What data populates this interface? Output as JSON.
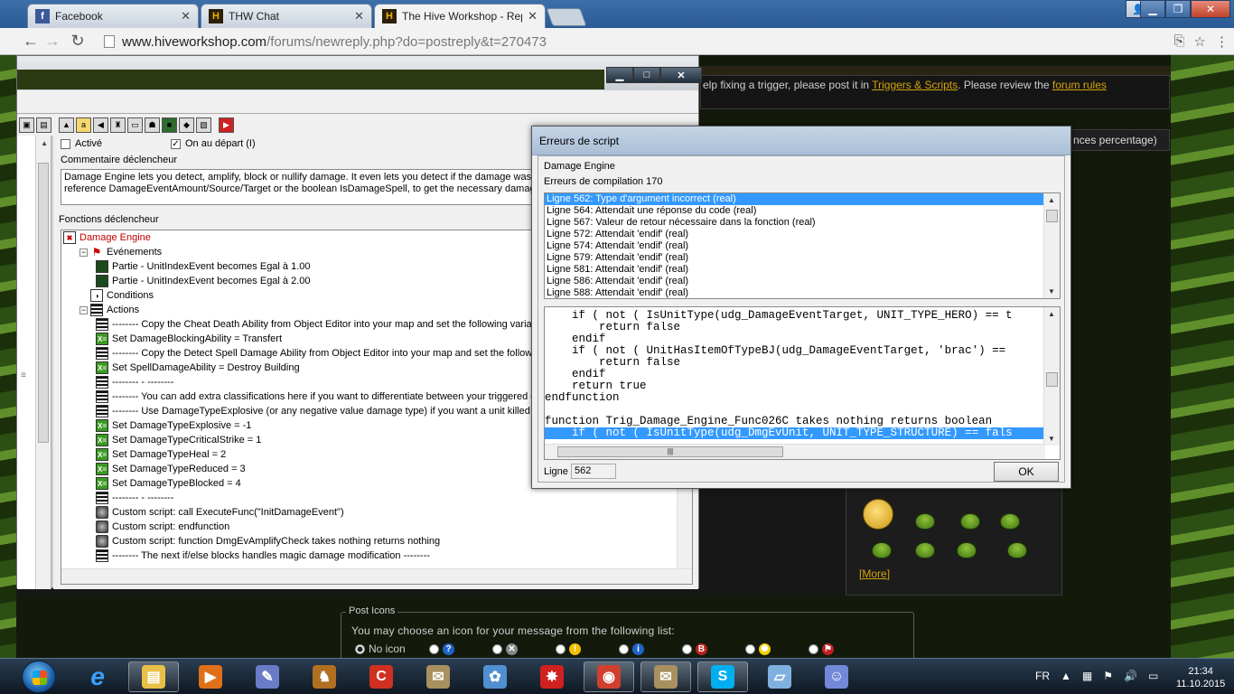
{
  "browser": {
    "tabs": [
      {
        "title": "Facebook",
        "favicon": "facebook-icon",
        "active": false
      },
      {
        "title": "THW Chat",
        "favicon": "hive-icon",
        "active": false
      },
      {
        "title": "The Hive Workshop - Rep",
        "favicon": "hive-icon",
        "active": true
      }
    ],
    "url_host": "www.hiveworkshop.com",
    "url_path": "/forums/newreply.php?do=postreply&t=270473"
  },
  "forum": {
    "notice_prefix": "elp fixing a trigger, please post it in ",
    "notice_link1": "Triggers & Scripts",
    "notice_mid": ". Please review the ",
    "notice_link2": "forum rules",
    "thread_title_fragment": "nces percentage)",
    "more_link": "More",
    "post_icons": {
      "legend": "Post Icons",
      "instruction": "You may choose an icon for your message from the following list:",
      "no_icon_label": "No icon",
      "options": [
        {
          "icon": "question-icon",
          "color": "#1e63c8"
        },
        {
          "icon": "swords-icon",
          "color": "#888888"
        },
        {
          "icon": "warning-icon",
          "color": "#f0c000"
        },
        {
          "icon": "info-icon",
          "color": "#1e63c8"
        },
        {
          "icon": "bug-icon",
          "color": "#c02020"
        },
        {
          "icon": "idea-icon",
          "color": "#f0d000"
        },
        {
          "icon": "flag-icon",
          "color": "#c02020"
        }
      ]
    }
  },
  "trigger_editor": {
    "enabled_label": "Activé",
    "initially_on_label": "On au départ (I)",
    "comment_label": "Commentaire déclencheur",
    "comment_line1": "Damage Engine lets you detect, amplify, block or nullify damage. It even lets you detect if the damage was phy",
    "comment_line2": "reference DamageEventAmount/Source/Target or the boolean IsDamageSpell, to get the necessary damage e",
    "functions_label": "Fonctions déclencheur",
    "tree": [
      {
        "depth": 0,
        "type": "root",
        "text": "Damage Engine"
      },
      {
        "depth": 1,
        "type": "flag",
        "text": "Evénements"
      },
      {
        "depth": 2,
        "type": "evt",
        "text": "Partie - UnitIndexEvent becomes Egal à 1.00"
      },
      {
        "depth": 2,
        "type": "evt",
        "text": "Partie - UnitIndexEvent becomes Egal à 2.00"
      },
      {
        "depth": 1,
        "type": "cond",
        "text": "Conditions"
      },
      {
        "depth": 1,
        "type": "act",
        "text": "Actions"
      },
      {
        "depth": 2,
        "type": "act",
        "text": "-------- Copy the Cheat Death Ability from Object Editor into your map and set the following variable r"
      },
      {
        "depth": 2,
        "type": "set",
        "text": "Set DamageBlockingAbility = Transfert"
      },
      {
        "depth": 2,
        "type": "act",
        "text": "-------- Copy the Detect Spell Damage Ability from Object Editor into your map and set the following v"
      },
      {
        "depth": 2,
        "type": "set",
        "text": "Set SpellDamageAbility = Destroy Building"
      },
      {
        "depth": 2,
        "type": "act",
        "text": "-------- - --------"
      },
      {
        "depth": 2,
        "type": "act",
        "text": "-------- You can add extra classifications here if you want to differentiate between your triggered dam"
      },
      {
        "depth": 2,
        "type": "act",
        "text": "-------- Use DamageTypeExplosive (or any negative value damage type) if you want a unit killed by t"
      },
      {
        "depth": 2,
        "type": "set",
        "text": "Set DamageTypeExplosive = -1"
      },
      {
        "depth": 2,
        "type": "set",
        "text": "Set DamageTypeCriticalStrike = 1"
      },
      {
        "depth": 2,
        "type": "set",
        "text": "Set DamageTypeHeal = 2"
      },
      {
        "depth": 2,
        "type": "set",
        "text": "Set DamageTypeReduced = 3"
      },
      {
        "depth": 2,
        "type": "set",
        "text": "Set DamageTypeBlocked = 4"
      },
      {
        "depth": 2,
        "type": "act",
        "text": "-------- - --------"
      },
      {
        "depth": 2,
        "type": "custom",
        "text": "Custom script:     call ExecuteFunc(\"InitDamageEvent\")"
      },
      {
        "depth": 2,
        "type": "custom",
        "text": "Custom script:   endfunction"
      },
      {
        "depth": 2,
        "type": "custom",
        "text": "Custom script:   function DmgEvAmplifyCheck takes nothing returns nothing"
      },
      {
        "depth": 2,
        "type": "act",
        "text": "-------- The next if/else blocks handles magic damage modification --------"
      }
    ]
  },
  "error_dialog": {
    "title": "Erreurs de script",
    "trigger_name": "Damage Engine",
    "error_count": "Erreurs de compilation 170",
    "errors": [
      "Ligne 562: Type d'argument incorrect (real)",
      "Ligne 564: Attendait une réponse du code (real)",
      "Ligne 567: Valeur de retour nécessaire dans la fonction (real)",
      "Ligne 572: Attendait 'endif' (real)",
      "Ligne 574: Attendait 'endif' (real)",
      "Ligne 579: Attendait 'endif' (real)",
      "Ligne 581: Attendait 'endif' (real)",
      "Ligne 586: Attendait 'endif' (real)",
      "Ligne 588: Attendait 'endif' (real)"
    ],
    "selected_error": 0,
    "code_lines": [
      "    if ( not ( IsUnitType(udg_DamageEventTarget, UNIT_TYPE_HERO) == t",
      "        return false",
      "    endif",
      "    if ( not ( UnitHasItemOfTypeBJ(udg_DamageEventTarget, 'brac') ==",
      "        return false",
      "    endif",
      "    return true",
      "endfunction",
      "",
      "function Trig_Damage_Engine_Func026C takes nothing returns boolean",
      "    if ( not ( IsUnitType(udg_DmgEvUnit, UNIT_TYPE_STRUCTURE) == fals"
    ],
    "selected_code_line": 10,
    "line_label": "Ligne",
    "line_value": "562",
    "ok_label": "OK"
  },
  "taskbar": {
    "apps": [
      {
        "icon": "file-explorer-icon",
        "color": "#e8c048",
        "running": true
      },
      {
        "icon": "media-player-icon",
        "color": "#e07018",
        "running": false
      },
      {
        "icon": "world-editor-icon",
        "color": "#6a7cc8",
        "running": false
      },
      {
        "icon": "dragon-game-icon",
        "color": "#b07020",
        "running": false
      },
      {
        "icon": "ccleaner-icon",
        "color": "#d03020",
        "running": false
      },
      {
        "icon": "scroll-editor-icon",
        "color": "#a89060",
        "running": false
      },
      {
        "icon": "paint-icon",
        "color": "#5090d0",
        "running": false
      },
      {
        "icon": "red-splat-icon",
        "color": "#d02020",
        "running": false
      },
      {
        "icon": "chrome-icon",
        "color": "#d04030",
        "running": true
      },
      {
        "icon": "scroll-editor-icon",
        "color": "#a89060",
        "running": true
      },
      {
        "icon": "skype-icon",
        "color": "#00aff0",
        "running": true
      },
      {
        "icon": "notepad-icon",
        "color": "#80b0e0",
        "running": false
      },
      {
        "icon": "discord-icon",
        "color": "#7289da",
        "running": false
      }
    ],
    "language": "FR",
    "time": "21:34",
    "date": "11.10.2015"
  }
}
